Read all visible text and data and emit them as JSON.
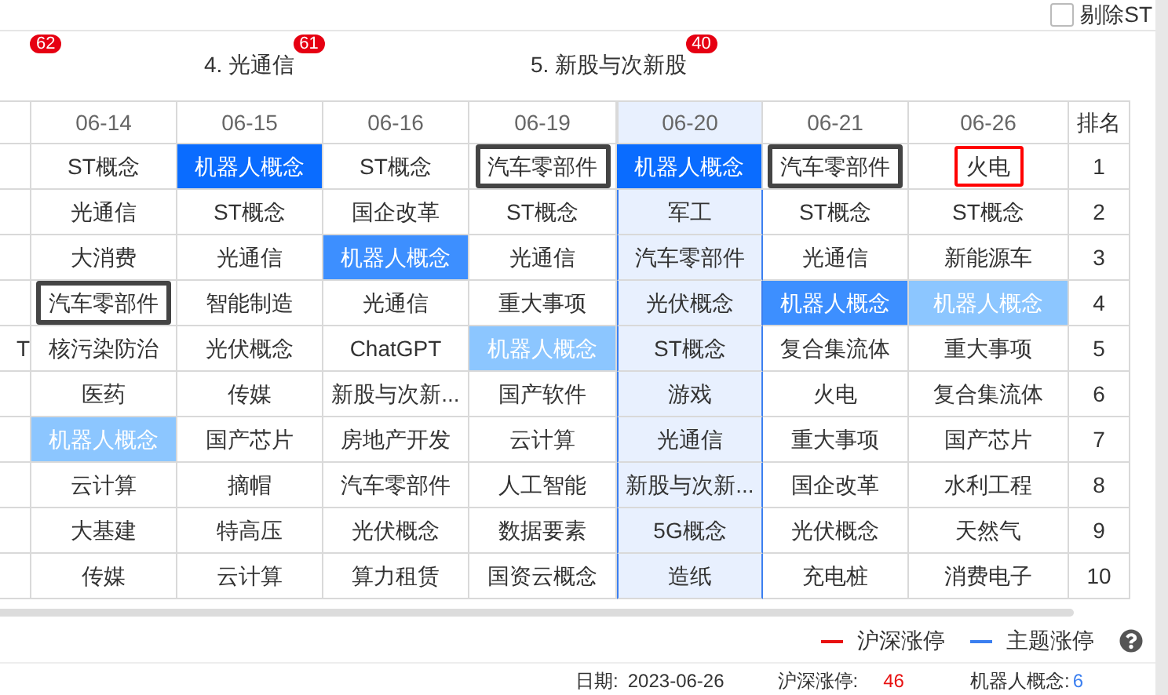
{
  "filter": {
    "label": "剔除ST",
    "checked": false
  },
  "top_themes": [
    {
      "count": "62"
    },
    {
      "label": "4. 光通信",
      "count": "61"
    },
    {
      "label": "5. 新股与次新股",
      "count": "40"
    }
  ],
  "table": {
    "columns": [
      {
        "date": "06-14",
        "selected": false
      },
      {
        "date": "06-15",
        "selected": false
      },
      {
        "date": "06-16",
        "selected": false
      },
      {
        "date": "06-19",
        "selected": false
      },
      {
        "date": "06-20",
        "selected": true
      },
      {
        "date": "06-21",
        "selected": false
      },
      {
        "date": "06-26",
        "selected": false
      }
    ],
    "rank_header": "排名",
    "rows": [
      {
        "rank": "1",
        "cells": [
          {
            "text": "ST概念",
            "kind": "plain"
          },
          {
            "text": "机器人概念",
            "kind": "blue"
          },
          {
            "text": "ST概念",
            "kind": "plain"
          },
          {
            "text": "汽车零部件",
            "kind": "outlined"
          },
          {
            "text": "机器人概念",
            "kind": "blue"
          },
          {
            "text": "汽车零部件",
            "kind": "outlined"
          },
          {
            "text": "火电",
            "kind": "red_outlined"
          }
        ]
      },
      {
        "rank": "2",
        "cells": [
          {
            "text": "光通信",
            "kind": "plain"
          },
          {
            "text": "ST概念",
            "kind": "plain"
          },
          {
            "text": "国企改革",
            "kind": "plain"
          },
          {
            "text": "ST概念",
            "kind": "plain"
          },
          {
            "text": "军工",
            "kind": "plain"
          },
          {
            "text": "ST概念",
            "kind": "plain"
          },
          {
            "text": "ST概念",
            "kind": "plain"
          }
        ]
      },
      {
        "rank": "3",
        "cells": [
          {
            "text": "大消费",
            "kind": "plain"
          },
          {
            "text": "光通信",
            "kind": "plain"
          },
          {
            "text": "机器人概念",
            "kind": "mid_blue"
          },
          {
            "text": "光通信",
            "kind": "plain"
          },
          {
            "text": "汽车零部件",
            "kind": "plain"
          },
          {
            "text": "光通信",
            "kind": "plain"
          },
          {
            "text": "新能源车",
            "kind": "plain"
          }
        ]
      },
      {
        "rank": "4",
        "cells": [
          {
            "text": "汽车零部件",
            "kind": "outlined"
          },
          {
            "text": "智能制造",
            "kind": "plain"
          },
          {
            "text": "光通信",
            "kind": "plain"
          },
          {
            "text": "重大事项",
            "kind": "plain"
          },
          {
            "text": "光伏概念",
            "kind": "plain"
          },
          {
            "text": "机器人概念",
            "kind": "mid_blue"
          },
          {
            "text": "机器人概念",
            "kind": "light_blue"
          }
        ]
      },
      {
        "rank": "5",
        "left": "T",
        "cells": [
          {
            "text": "核污染防治",
            "kind": "plain"
          },
          {
            "text": "光伏概念",
            "kind": "plain"
          },
          {
            "text": "ChatGPT",
            "kind": "plain"
          },
          {
            "text": "机器人概念",
            "kind": "light_blue"
          },
          {
            "text": "ST概念",
            "kind": "plain"
          },
          {
            "text": "复合集流体",
            "kind": "plain"
          },
          {
            "text": "重大事项",
            "kind": "plain"
          }
        ]
      },
      {
        "rank": "6",
        "cells": [
          {
            "text": "医药",
            "kind": "plain"
          },
          {
            "text": "传媒",
            "kind": "plain"
          },
          {
            "text": "新股与次新...",
            "kind": "plain"
          },
          {
            "text": "国产软件",
            "kind": "plain"
          },
          {
            "text": "游戏",
            "kind": "plain"
          },
          {
            "text": "火电",
            "kind": "plain"
          },
          {
            "text": "复合集流体",
            "kind": "plain"
          }
        ]
      },
      {
        "rank": "7",
        "cells": [
          {
            "text": "机器人概念",
            "kind": "light_blue"
          },
          {
            "text": "国产芯片",
            "kind": "plain"
          },
          {
            "text": "房地产开发",
            "kind": "plain"
          },
          {
            "text": "云计算",
            "kind": "plain"
          },
          {
            "text": "光通信",
            "kind": "plain"
          },
          {
            "text": "重大事项",
            "kind": "plain"
          },
          {
            "text": "国产芯片",
            "kind": "plain"
          }
        ]
      },
      {
        "rank": "8",
        "cells": [
          {
            "text": "云计算",
            "kind": "plain"
          },
          {
            "text": "摘帽",
            "kind": "plain"
          },
          {
            "text": "汽车零部件",
            "kind": "plain"
          },
          {
            "text": "人工智能",
            "kind": "plain"
          },
          {
            "text": "新股与次新...",
            "kind": "plain"
          },
          {
            "text": "国企改革",
            "kind": "plain"
          },
          {
            "text": "水利工程",
            "kind": "plain"
          }
        ]
      },
      {
        "rank": "9",
        "cells": [
          {
            "text": "大基建",
            "kind": "plain"
          },
          {
            "text": "特高压",
            "kind": "plain"
          },
          {
            "text": "光伏概念",
            "kind": "plain"
          },
          {
            "text": "数据要素",
            "kind": "plain"
          },
          {
            "text": "5G概念",
            "kind": "plain"
          },
          {
            "text": "光伏概念",
            "kind": "plain"
          },
          {
            "text": "天然气",
            "kind": "plain"
          }
        ]
      },
      {
        "rank": "10",
        "cells": [
          {
            "text": "传媒",
            "kind": "plain"
          },
          {
            "text": "云计算",
            "kind": "plain"
          },
          {
            "text": "算力租赁",
            "kind": "plain"
          },
          {
            "text": "国资云概念",
            "kind": "plain"
          },
          {
            "text": "造纸",
            "kind": "plain"
          },
          {
            "text": "充电桩",
            "kind": "plain"
          },
          {
            "text": "消费电子",
            "kind": "plain"
          }
        ]
      }
    ]
  },
  "legend": [
    {
      "label": "沪深涨停",
      "color": "#e81010"
    },
    {
      "label": "主题涨停",
      "color": "#3b7ff0"
    }
  ],
  "footer": {
    "date_label": "日期:",
    "date": "2023-06-26",
    "market_label": "沪深涨停:",
    "market_count": "46",
    "theme_label": "机器人概念:",
    "theme_count": "6"
  }
}
